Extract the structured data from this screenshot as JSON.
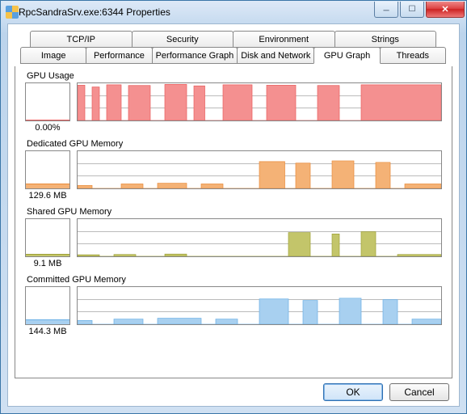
{
  "window": {
    "title": "RpcSandraSrv.exe:6344 Properties"
  },
  "tabs": {
    "row1": [
      {
        "label": "TCP/IP"
      },
      {
        "label": "Security"
      },
      {
        "label": "Environment"
      },
      {
        "label": "Strings"
      }
    ],
    "row2": [
      {
        "label": "Image"
      },
      {
        "label": "Performance"
      },
      {
        "label": "Performance Graph"
      },
      {
        "label": "Disk and Network"
      },
      {
        "label": "GPU Graph",
        "active": true
      },
      {
        "label": "Threads"
      }
    ]
  },
  "sections": [
    {
      "id": "gpu_usage",
      "title": "GPU Usage",
      "value": "0.00%",
      "color": "#f49090",
      "stroke": "#e85c5c",
      "mini_pct": 0,
      "bars": [
        [
          0,
          95
        ],
        [
          4,
          6,
          90
        ],
        [
          8,
          12,
          96
        ],
        [
          14,
          20,
          94
        ],
        [
          24,
          30,
          97
        ],
        [
          32,
          35,
          93
        ],
        [
          40,
          48,
          96
        ],
        [
          52,
          60,
          95
        ],
        [
          66,
          72,
          94
        ],
        [
          78,
          100,
          96
        ]
      ]
    },
    {
      "id": "dedicated_gpu_memory",
      "title": "Dedicated GPU Memory",
      "value": "129.6 MB",
      "color": "#f4b276",
      "stroke": "#e88b3a",
      "mini_pct": 14,
      "bars": [
        [
          0,
          4,
          8
        ],
        [
          12,
          18,
          12
        ],
        [
          22,
          30,
          14
        ],
        [
          34,
          40,
          12
        ],
        [
          50,
          57,
          72
        ],
        [
          60,
          64,
          68
        ],
        [
          70,
          76,
          74
        ],
        [
          82,
          86,
          70
        ],
        [
          90,
          100,
          12
        ]
      ]
    },
    {
      "id": "shared_gpu_memory",
      "title": "Shared GPU Memory",
      "value": "9.1 MB",
      "color": "#c3c56a",
      "stroke": "#9ea035",
      "mini_pct": 6,
      "bars": [
        [
          0,
          6,
          4
        ],
        [
          10,
          16,
          5
        ],
        [
          24,
          30,
          6
        ],
        [
          58,
          64,
          64
        ],
        [
          70,
          72,
          60
        ],
        [
          78,
          82,
          66
        ],
        [
          88,
          100,
          5
        ]
      ]
    },
    {
      "id": "committed_gpu_memory",
      "title": "Committed GPU Memory",
      "value": "144.3 MB",
      "color": "#a8d0f0",
      "stroke": "#6bb0e6",
      "mini_pct": 14,
      "bars": [
        [
          0,
          4,
          10
        ],
        [
          10,
          18,
          14
        ],
        [
          22,
          34,
          16
        ],
        [
          38,
          44,
          14
        ],
        [
          50,
          58,
          68
        ],
        [
          62,
          66,
          64
        ],
        [
          72,
          78,
          70
        ],
        [
          84,
          88,
          66
        ],
        [
          92,
          100,
          14
        ]
      ]
    }
  ],
  "buttons": {
    "ok": "OK",
    "cancel": "Cancel"
  },
  "chart_data": [
    {
      "type": "area",
      "title": "GPU Usage",
      "ylabel": "%",
      "ylim": [
        0,
        100
      ],
      "current": 0.0
    },
    {
      "type": "area",
      "title": "Dedicated GPU Memory",
      "ylabel": "MB",
      "current": 129.6
    },
    {
      "type": "area",
      "title": "Shared GPU Memory",
      "ylabel": "MB",
      "current": 9.1
    },
    {
      "type": "area",
      "title": "Committed GPU Memory",
      "ylabel": "MB",
      "current": 144.3
    }
  ]
}
